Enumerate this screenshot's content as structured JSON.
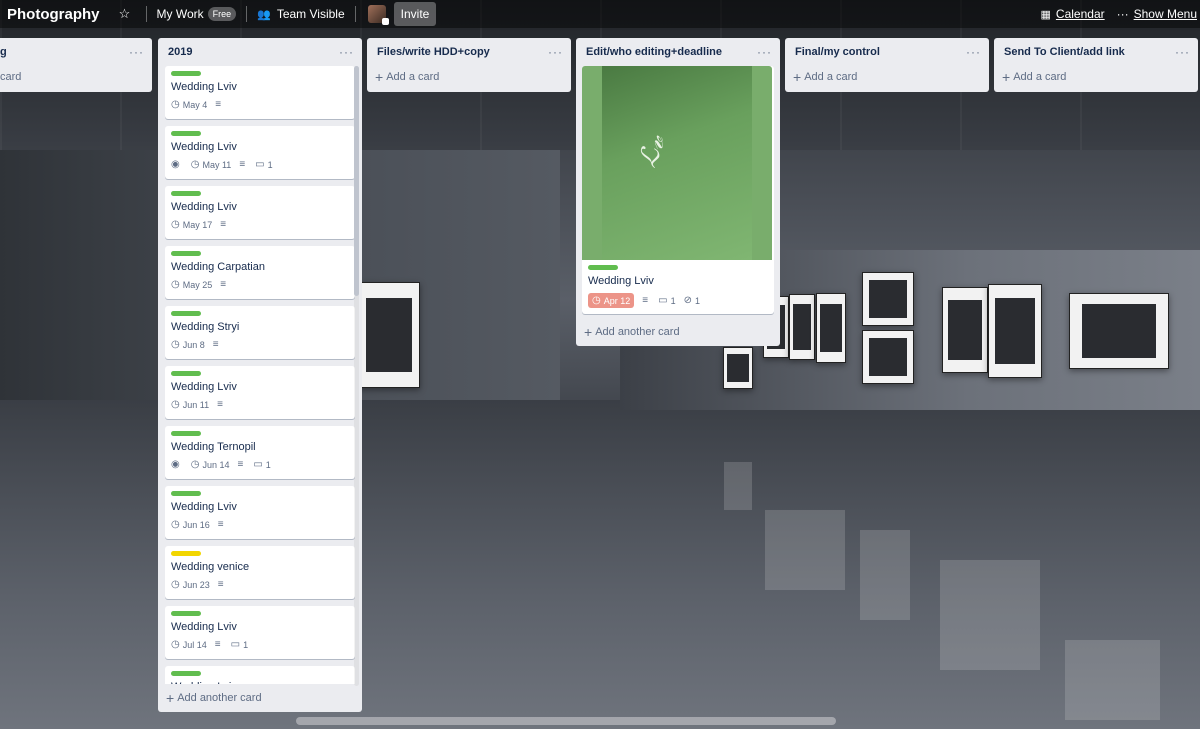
{
  "header": {
    "board_title": "Photography",
    "workspace": "My Work",
    "workspace_badge": "Free",
    "visibility": "Team Visible",
    "invite_label": "Invite",
    "calendar_label": "Calendar",
    "show_menu_label": "Show Menu",
    "icons": [
      "star-icon",
      "team-icon",
      "calendar-icon",
      "dots-icon"
    ]
  },
  "colors": {
    "green_label": "#61bd4f",
    "yellow_label": "#f2d600",
    "overdue": "#ec9488"
  },
  "lists": [
    {
      "title": "",
      "partial_title": "g",
      "add_label": "card"
    },
    {
      "title": "2019",
      "add_label": "Add another card",
      "cards": [
        {
          "label": "green",
          "title": "Wedding Lviv",
          "watch": false,
          "due": "May 4",
          "desc": true,
          "comments": ""
        },
        {
          "label": "green",
          "title": "Wedding Lviv",
          "watch": true,
          "due": "May 11",
          "desc": true,
          "comments": "1"
        },
        {
          "label": "green",
          "title": "Wedding Lviv",
          "watch": false,
          "due": "May 17",
          "desc": true,
          "comments": ""
        },
        {
          "label": "green",
          "title": "Wedding Carpatian",
          "watch": false,
          "due": "May 25",
          "desc": true,
          "comments": ""
        },
        {
          "label": "green",
          "title": "Wedding Stryi",
          "watch": false,
          "due": "Jun 8",
          "desc": true,
          "comments": ""
        },
        {
          "label": "green",
          "title": "Wedding Lviv",
          "watch": false,
          "due": "Jun 11",
          "desc": true,
          "comments": ""
        },
        {
          "label": "green",
          "title": "Wedding Ternopil",
          "watch": true,
          "due": "Jun 14",
          "desc": true,
          "comments": "1"
        },
        {
          "label": "green",
          "title": "Wedding Lviv",
          "watch": false,
          "due": "Jun 16",
          "desc": true,
          "comments": ""
        },
        {
          "label": "yellow",
          "title": "Wedding venice",
          "watch": false,
          "due": "Jun 23",
          "desc": true,
          "comments": ""
        },
        {
          "label": "green",
          "title": "Wedding Lviv",
          "watch": false,
          "due": "Jul 14",
          "desc": true,
          "comments": "1"
        },
        {
          "label": "green",
          "title": "Wedding Lviv",
          "watch": false,
          "due": "",
          "desc": false,
          "comments": ""
        }
      ]
    },
    {
      "title": "Files/write HDD+copy",
      "add_label": "Add a card"
    },
    {
      "title": "Edit/who editing+deadline",
      "add_label": "Add another card",
      "cover_card": {
        "label": "green",
        "title": "Wedding Lviv",
        "due": "Apr 12",
        "comments": "1",
        "attachments": "1"
      }
    },
    {
      "title": "Final/my control",
      "add_label": "Add a card"
    },
    {
      "title": "Send To Client/add link",
      "add_label": "Add a card"
    }
  ]
}
